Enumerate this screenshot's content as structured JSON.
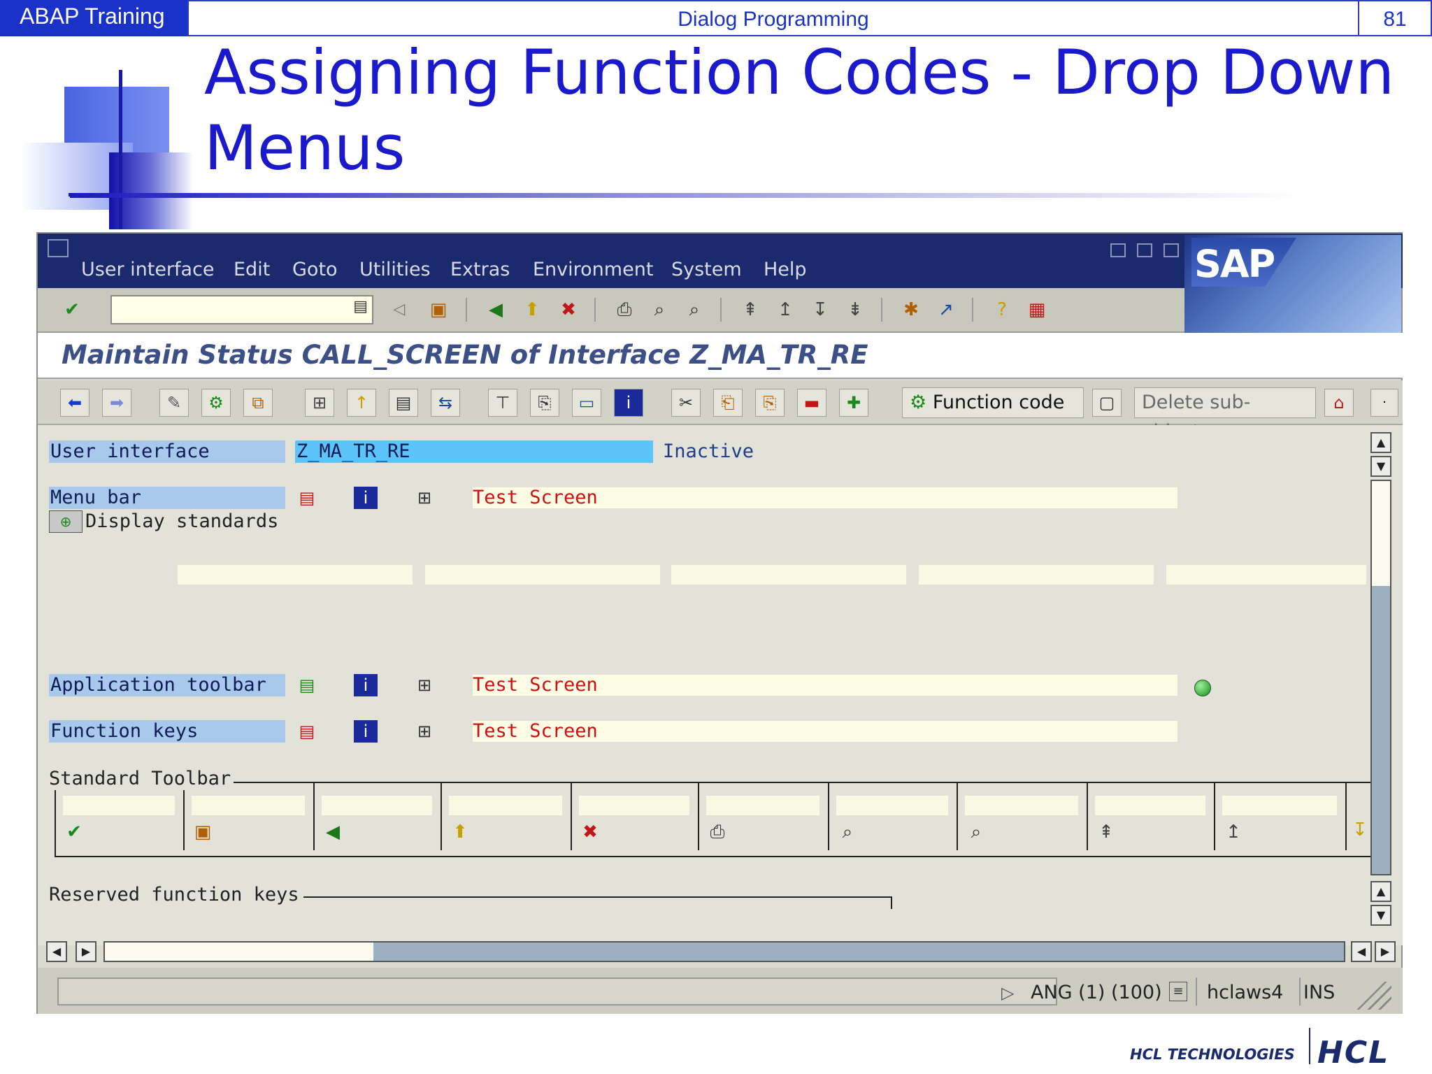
{
  "slide": {
    "course": "ABAP Training",
    "section": "Dialog Programming",
    "page": "81",
    "title_line1": "Assigning Function Codes - Drop Down",
    "title_line2": "Menus"
  },
  "sap": {
    "menu": [
      "User interface",
      "Edit",
      "Goto",
      "Utilities",
      "Extras",
      "Environment",
      "System",
      "Help"
    ],
    "window_title": "Maintain Status CALL_SCREEN of Interface Z_MA_TR_RE",
    "logo_text": "SAP",
    "app_toolbar": {
      "function_code_label": "Function code",
      "delete_subobject_label": "Delete sub-object"
    },
    "content": {
      "user_interface_label": "User interface",
      "user_interface_value": "Z_MA_TR_RE",
      "status": "Inactive",
      "menu_bar_label": "Menu bar",
      "menu_bar_value": "Test Screen",
      "display_standards_label": "Display standards",
      "application_toolbar_label": "Application toolbar",
      "application_toolbar_value": "Test Screen",
      "function_keys_label": "Function keys",
      "function_keys_value": "Test Screen",
      "standard_toolbar_label": "Standard Toolbar",
      "reserved_function_keys_label": "Reserved function keys"
    },
    "statusbar": {
      "system": "ANG (1) (100)",
      "server": "hclaws4",
      "mode": "INS"
    }
  },
  "footer": {
    "company_text": "HCL TECHNOLOGIES",
    "logo_text": "HCL"
  },
  "colors": {
    "sap_menubar": "#1a2a6c",
    "slide_accent": "#1a32c8",
    "field_label_bg": "#a8c8ec",
    "highlight_value": "#5cc4f8",
    "red_text": "#d01010"
  }
}
